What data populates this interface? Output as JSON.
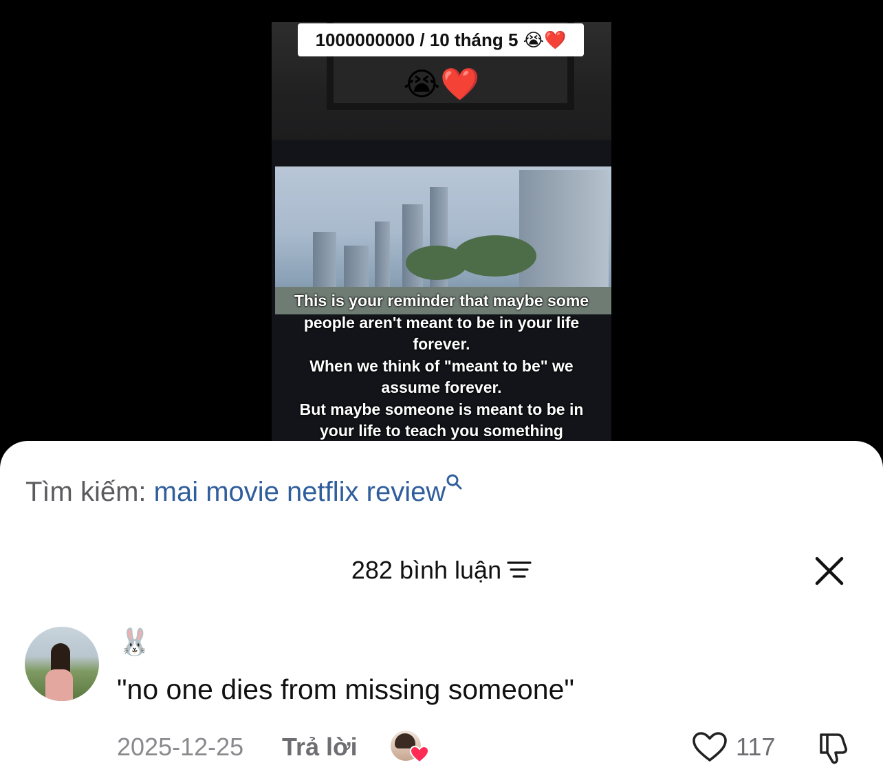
{
  "video": {
    "top_caption": "1000000000 / 10 tháng 5 😭❤️",
    "emoji_line": "😭❤️",
    "subtitle_lines": [
      "This is your reminder that maybe some",
      "people aren't meant to be in your life",
      "forever.",
      "When we think of \"meant to be\" we",
      "assume forever.",
      "But maybe someone is meant to be in",
      "your life to teach you something"
    ]
  },
  "search": {
    "label": "Tìm kiếm:",
    "query": "mai movie netflix review",
    "icon": "search-icon"
  },
  "comments_header": {
    "count_text": "282 bình luận",
    "filter_icon": "filter-icon",
    "close_icon": "close-icon"
  },
  "comment": {
    "username": "🐰",
    "text": "\"no one dies from missing someone\"",
    "date": "2025-12-25",
    "reply_label": "Trả lời",
    "like_count": "117",
    "liked_by_creator": true
  },
  "colors": {
    "search_query": "#2f5e9c",
    "secondary_text": "#8a8a8e",
    "heart_red": "#fe2c55"
  }
}
